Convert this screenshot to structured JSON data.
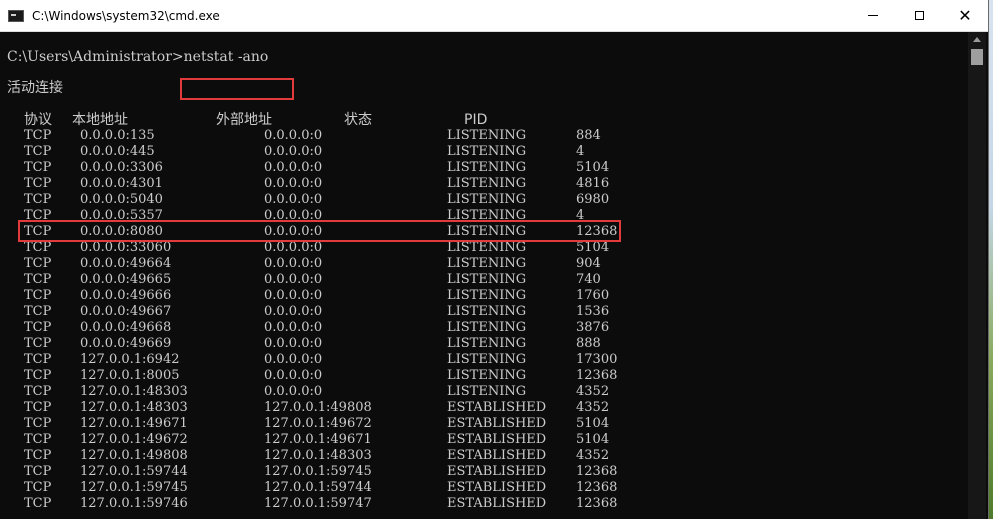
{
  "window": {
    "title": "C:\\Windows\\system32\\cmd.exe"
  },
  "console": {
    "prompt": "C:\\Users\\Administrator>",
    "command": "netstat -ano",
    "section_title": "活动连接",
    "headers": {
      "proto": "协议",
      "local": "本地地址",
      "foreign": "外部地址",
      "state": "状态",
      "pid": "PID"
    },
    "rows": [
      {
        "proto": "TCP",
        "local": "0.0.0.0:135",
        "foreign": "0.0.0.0:0",
        "state": "LISTENING",
        "pid": "884"
      },
      {
        "proto": "TCP",
        "local": "0.0.0.0:445",
        "foreign": "0.0.0.0:0",
        "state": "LISTENING",
        "pid": "4"
      },
      {
        "proto": "TCP",
        "local": "0.0.0.0:3306",
        "foreign": "0.0.0.0:0",
        "state": "LISTENING",
        "pid": "5104"
      },
      {
        "proto": "TCP",
        "local": "0.0.0.0:4301",
        "foreign": "0.0.0.0:0",
        "state": "LISTENING",
        "pid": "4816"
      },
      {
        "proto": "TCP",
        "local": "0.0.0.0:5040",
        "foreign": "0.0.0.0:0",
        "state": "LISTENING",
        "pid": "6980"
      },
      {
        "proto": "TCP",
        "local": "0.0.0.0:5357",
        "foreign": "0.0.0.0:0",
        "state": "LISTENING",
        "pid": "4"
      },
      {
        "proto": "TCP",
        "local": "0.0.0.0:8080",
        "foreign": "0.0.0.0:0",
        "state": "LISTENING",
        "pid": "12368",
        "highlighted": true
      },
      {
        "proto": "TCP",
        "local": "0.0.0.0:33060",
        "foreign": "0.0.0.0:0",
        "state": "LISTENING",
        "pid": "5104"
      },
      {
        "proto": "TCP",
        "local": "0.0.0.0:49664",
        "foreign": "0.0.0.0:0",
        "state": "LISTENING",
        "pid": "904"
      },
      {
        "proto": "TCP",
        "local": "0.0.0.0:49665",
        "foreign": "0.0.0.0:0",
        "state": "LISTENING",
        "pid": "740"
      },
      {
        "proto": "TCP",
        "local": "0.0.0.0:49666",
        "foreign": "0.0.0.0:0",
        "state": "LISTENING",
        "pid": "1760"
      },
      {
        "proto": "TCP",
        "local": "0.0.0.0:49667",
        "foreign": "0.0.0.0:0",
        "state": "LISTENING",
        "pid": "1536"
      },
      {
        "proto": "TCP",
        "local": "0.0.0.0:49668",
        "foreign": "0.0.0.0:0",
        "state": "LISTENING",
        "pid": "3876"
      },
      {
        "proto": "TCP",
        "local": "0.0.0.0:49669",
        "foreign": "0.0.0.0:0",
        "state": "LISTENING",
        "pid": "888"
      },
      {
        "proto": "TCP",
        "local": "127.0.0.1:6942",
        "foreign": "0.0.0.0:0",
        "state": "LISTENING",
        "pid": "17300"
      },
      {
        "proto": "TCP",
        "local": "127.0.0.1:8005",
        "foreign": "0.0.0.0:0",
        "state": "LISTENING",
        "pid": "12368"
      },
      {
        "proto": "TCP",
        "local": "127.0.0.1:48303",
        "foreign": "0.0.0.0:0",
        "state": "LISTENING",
        "pid": "4352"
      },
      {
        "proto": "TCP",
        "local": "127.0.0.1:48303",
        "foreign": "127.0.0.1:49808",
        "state": "ESTABLISHED",
        "pid": "4352"
      },
      {
        "proto": "TCP",
        "local": "127.0.0.1:49671",
        "foreign": "127.0.0.1:49672",
        "state": "ESTABLISHED",
        "pid": "5104"
      },
      {
        "proto": "TCP",
        "local": "127.0.0.1:49672",
        "foreign": "127.0.0.1:49671",
        "state": "ESTABLISHED",
        "pid": "5104"
      },
      {
        "proto": "TCP",
        "local": "127.0.0.1:49808",
        "foreign": "127.0.0.1:48303",
        "state": "ESTABLISHED",
        "pid": "4352"
      },
      {
        "proto": "TCP",
        "local": "127.0.0.1:59744",
        "foreign": "127.0.0.1:59745",
        "state": "ESTABLISHED",
        "pid": "12368"
      },
      {
        "proto": "TCP",
        "local": "127.0.0.1:59745",
        "foreign": "127.0.0.1:59744",
        "state": "ESTABLISHED",
        "pid": "12368"
      },
      {
        "proto": "TCP",
        "local": "127.0.0.1:59746",
        "foreign": "127.0.0.1:59747",
        "state": "ESTABLISHED",
        "pid": "12368"
      }
    ]
  },
  "colors": {
    "console_bg": "#0c0c0c",
    "console_text": "#cccccc",
    "highlight_box": "#e23b3b",
    "titlebar_bg": "#ffffff"
  },
  "icons": {
    "app": "cmd-icon",
    "minimize": "minimize-icon",
    "maximize": "maximize-icon",
    "close": "close-icon"
  }
}
